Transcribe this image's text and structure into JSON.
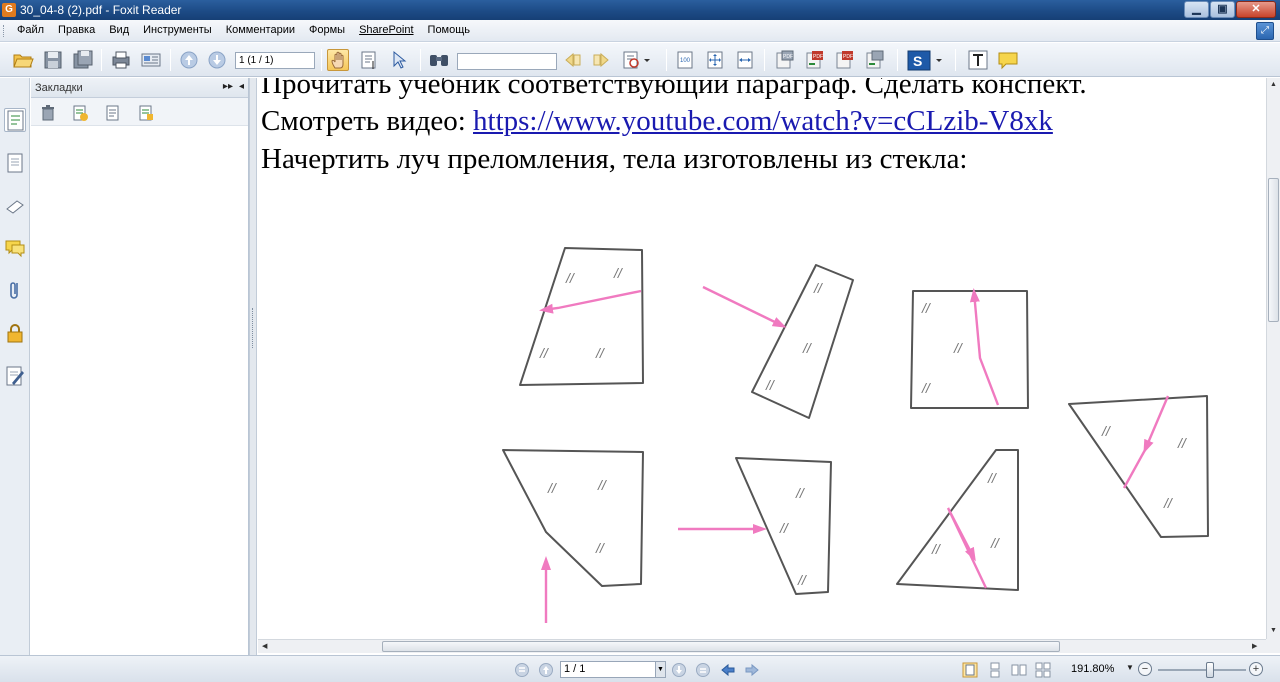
{
  "window": {
    "app_icon_letter": "G",
    "title": "30_04-8 (2).pdf - Foxit Reader",
    "minimize": "▁",
    "restore": "▣",
    "close": "✕"
  },
  "menu": {
    "items": [
      "Файл",
      "Правка",
      "Вид",
      "Инструменты",
      "Комментарии",
      "Формы",
      "SharePoint",
      "Помощь"
    ]
  },
  "toolbar": {
    "page_field_value": "1 (1 / 1)",
    "search_value": ""
  },
  "bookmarks_panel": {
    "title": "Закладки",
    "ctrl_expand": "▸▸",
    "ctrl_collapse": "◂"
  },
  "document": {
    "line1": "Прочитать учебник соответствующий параграф. Сделать конспект.",
    "line2_prefix": "Смотреть видео: ",
    "line2_link": "https://www.youtube.com/watch?v=cCLzib-V8xk",
    "line3": "Начертить луч преломления, тела изготовлены из стекла:",
    "figure_mark": "//",
    "ray_color": "#f07ac0",
    "outline_color": "#555555"
  },
  "statusbar": {
    "page_value": "1 / 1",
    "zoom_value": "191.80%",
    "zoom_level_percent": 60,
    "zoom_out": "−",
    "zoom_in": "+"
  },
  "colors": {
    "titlebar": "#1d4b86",
    "accent": "#2a66b0"
  }
}
